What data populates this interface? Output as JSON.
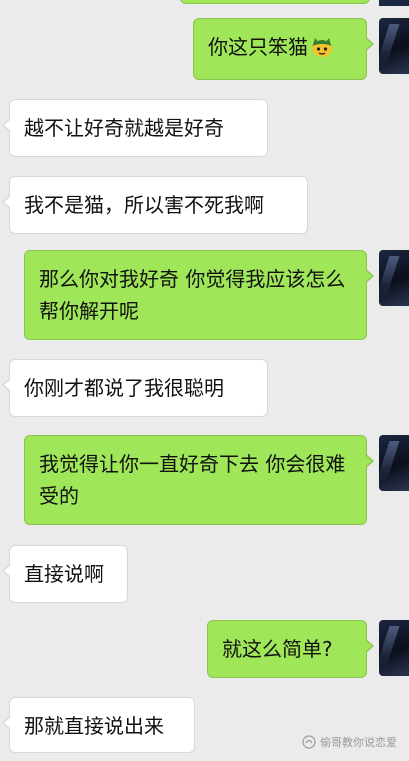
{
  "messages": [
    {
      "side": "out",
      "text": "你这只笨猫",
      "emoji": "cat-face-emoji"
    },
    {
      "side": "in",
      "text": "越不让好奇就越是好奇"
    },
    {
      "side": "in",
      "text": "我不是猫，所以害不死我啊"
    },
    {
      "side": "out",
      "text": "那么你对我好奇  你觉得我应该怎么帮你解开呢"
    },
    {
      "side": "in",
      "text": "你刚才都说了我很聪明"
    },
    {
      "side": "out",
      "text": "我觉得让你一直好奇下去  你会很难受的"
    },
    {
      "side": "in",
      "text": "直接说啊"
    },
    {
      "side": "out",
      "text": "就这么简单?"
    },
    {
      "side": "in",
      "text": "那就直接说出来"
    }
  ],
  "watermark": {
    "text": "偷哥教你说恋爱",
    "icon": "wechat-official-account-icon"
  },
  "colors": {
    "background": "#ebebeb",
    "outgoing": "#9fe658",
    "incoming": "#ffffff"
  }
}
